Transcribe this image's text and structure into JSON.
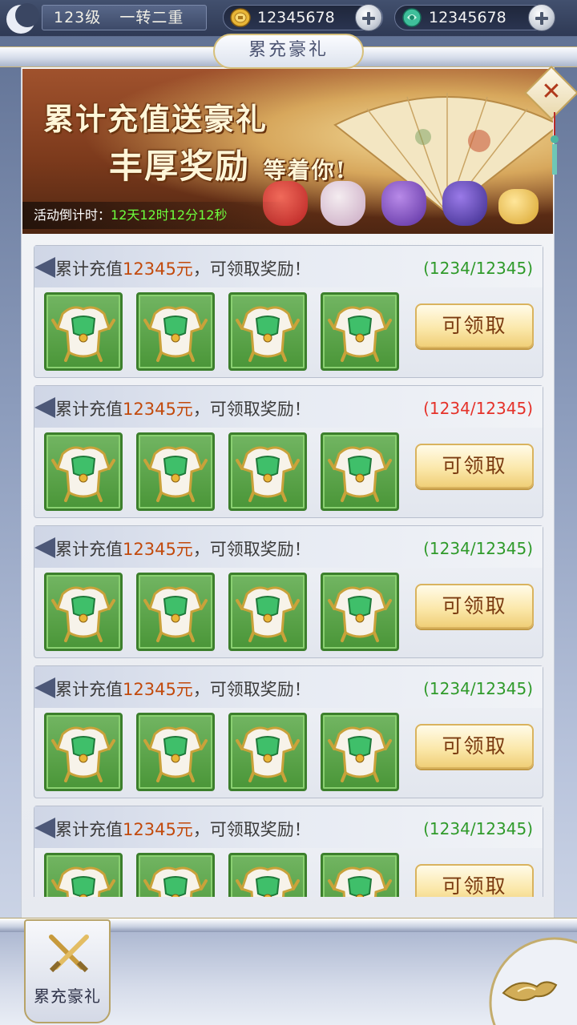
{
  "topbar": {
    "level": "123级",
    "rank": "一转二重",
    "gold": {
      "amount": "12345678",
      "icon": "gold-coin-icon"
    },
    "jade": {
      "amount": "12345678",
      "icon": "jade-icon"
    }
  },
  "page": {
    "title": "累充豪礼"
  },
  "banner": {
    "headline1": "累计充值送豪礼",
    "headline2_main": "丰厚奖励",
    "headline2_small": "等着你!",
    "countdown_label": "活动倒计时：",
    "countdown_value": "12天12时12分12秒"
  },
  "close_button": {
    "label": "✕",
    "icon": "close-icon"
  },
  "rewards": [
    {
      "title_prefix": "累计充值",
      "amount": "12345元",
      "title_suffix": "，可领取奖励！",
      "progress": "(1234/12345)",
      "progress_color": "#2f9a2a",
      "claim_label": "可领取",
      "items": [
        "armor-icon",
        "armor-icon",
        "armor-icon",
        "armor-icon"
      ]
    },
    {
      "title_prefix": "累计充值",
      "amount": "12345元",
      "title_suffix": "，可领取奖励！",
      "progress": "(1234/12345)",
      "progress_color": "#e5322a",
      "claim_label": "可领取",
      "items": [
        "armor-icon",
        "armor-icon",
        "armor-icon",
        "armor-icon"
      ]
    },
    {
      "title_prefix": "累计充值",
      "amount": "12345元",
      "title_suffix": "，可领取奖励！",
      "progress": "(1234/12345)",
      "progress_color": "#2f9a2a",
      "claim_label": "可领取",
      "items": [
        "armor-icon",
        "armor-icon",
        "armor-icon",
        "armor-icon"
      ]
    },
    {
      "title_prefix": "累计充值",
      "amount": "12345元",
      "title_suffix": "，可领取奖励！",
      "progress": "(1234/12345)",
      "progress_color": "#2f9a2a",
      "claim_label": "可领取",
      "items": [
        "armor-icon",
        "armor-icon",
        "armor-icon",
        "armor-icon"
      ]
    },
    {
      "title_prefix": "累计充值",
      "amount": "12345元",
      "title_suffix": "，可领取奖励！",
      "progress": "(1234/12345)",
      "progress_color": "#2f9a2a",
      "claim_label": "可领取",
      "items": [
        "armor-icon",
        "armor-icon",
        "armor-icon",
        "armor-icon"
      ]
    }
  ],
  "bottom": {
    "tab_label": "累充豪礼",
    "tab_icon": "crossed-swords-icon",
    "menu_icon": "cloud-swirl-icon"
  },
  "colors": {
    "amount_highlight": "#c24a0c",
    "countdown_time": "#6dff3d",
    "claim_button": "#fbe8ab",
    "item_slot": "#5aa648"
  }
}
